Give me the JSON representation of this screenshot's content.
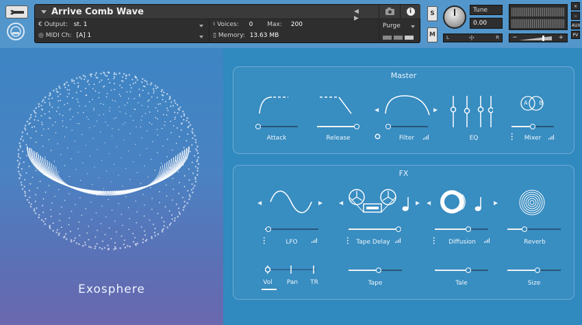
{
  "header": {
    "instrument_title": "Arrive Comb Wave",
    "output_label": "Output:",
    "output_value": "st. 1",
    "midi_label": "MIDI Ch:",
    "midi_value": "[A]  1",
    "voices_label": "Voices:",
    "voices_value": "0",
    "max_label": "Max:",
    "max_value": "200",
    "memory_label": "Memory:",
    "memory_value": "13.63 MB",
    "purge_label": "Purge",
    "solo_label": "S",
    "mute_label": "M",
    "tune_label": "Tune",
    "tune_value": "0.00",
    "pan_left": "L",
    "pan_center": "‹|›",
    "pan_right": "R",
    "vol_minus": "−",
    "vol_plus": "+",
    "side_close": "×",
    "side_min": "−",
    "side_aux": "AUX",
    "side_pv": "PV"
  },
  "left": {
    "product_name": "Exosphere"
  },
  "master": {
    "title": "Master",
    "attack_label": "Attack",
    "release_label": "Release",
    "filter_label": "Filter",
    "eq_label": "EQ",
    "mixer_label": "Mixer",
    "mixer_a": "A",
    "mixer_b": "B",
    "attack_value": 0.07,
    "release_value": 0.93,
    "filter_value": 0.07,
    "mixer_value": 0.5
  },
  "fx": {
    "title": "FX",
    "lfo_label": "LFO",
    "tape_delay_label": "Tape Delay",
    "diffusion_label": "Diffusion",
    "reverb_label": "Reverb",
    "vol_label": "Vol",
    "pan_label": "Pan",
    "tr_label": "TR",
    "tape_label": "Tape",
    "tale_label": "Tale",
    "size_label": "Size",
    "lfo_value": 0.06,
    "tape_delay_value": 0.93,
    "diffusion_value": 0.63,
    "reverb_value": 0.32,
    "tape_value": 0.56,
    "tale_value": 0.63,
    "size_value": 0.56
  },
  "colors": {
    "panel_bg": "#3089bf",
    "header_bg": "#5396cb",
    "accent": "#ffffff"
  }
}
